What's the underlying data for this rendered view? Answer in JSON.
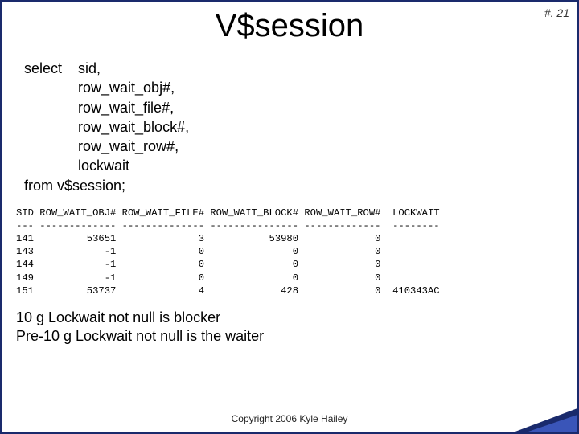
{
  "page_number": "#. 21",
  "title": "V$session",
  "sql": {
    "select_kw": "select",
    "columns": [
      "sid,",
      "row_wait_obj#,",
      "row_wait_file#,",
      "row_wait_block#,",
      "row_wait_row#,",
      "lockwait"
    ],
    "from_line": "from v$session;"
  },
  "chart_data": {
    "type": "table",
    "headers": [
      "SID",
      "ROW_WAIT_OBJ#",
      "ROW_WAIT_FILE#",
      "ROW_WAIT_BLOCK#",
      "ROW_WAIT_ROW#",
      "LOCKWAIT"
    ],
    "separators": [
      "---",
      "-------------",
      "--------------",
      "---------------",
      "-------------",
      "--------"
    ],
    "rows": [
      {
        "SID": 141,
        "ROW_WAIT_OBJ#": 53651,
        "ROW_WAIT_FILE#": 3,
        "ROW_WAIT_BLOCK#": 53980,
        "ROW_WAIT_ROW#": 0,
        "LOCKWAIT": ""
      },
      {
        "SID": 143,
        "ROW_WAIT_OBJ#": -1,
        "ROW_WAIT_FILE#": 0,
        "ROW_WAIT_BLOCK#": 0,
        "ROW_WAIT_ROW#": 0,
        "LOCKWAIT": ""
      },
      {
        "SID": 144,
        "ROW_WAIT_OBJ#": -1,
        "ROW_WAIT_FILE#": 0,
        "ROW_WAIT_BLOCK#": 0,
        "ROW_WAIT_ROW#": 0,
        "LOCKWAIT": ""
      },
      {
        "SID": 149,
        "ROW_WAIT_OBJ#": -1,
        "ROW_WAIT_FILE#": 0,
        "ROW_WAIT_BLOCK#": 0,
        "ROW_WAIT_ROW#": 0,
        "LOCKWAIT": ""
      },
      {
        "SID": 151,
        "ROW_WAIT_OBJ#": 53737,
        "ROW_WAIT_FILE#": 4,
        "ROW_WAIT_BLOCK#": 428,
        "ROW_WAIT_ROW#": 0,
        "LOCKWAIT": "410343AC"
      }
    ]
  },
  "notes": {
    "line1": "10 g Lockwait not null is blocker",
    "line2": "Pre-10 g Lockwait not null is the waiter"
  },
  "copyright": "Copyright 2006 Kyle Hailey"
}
